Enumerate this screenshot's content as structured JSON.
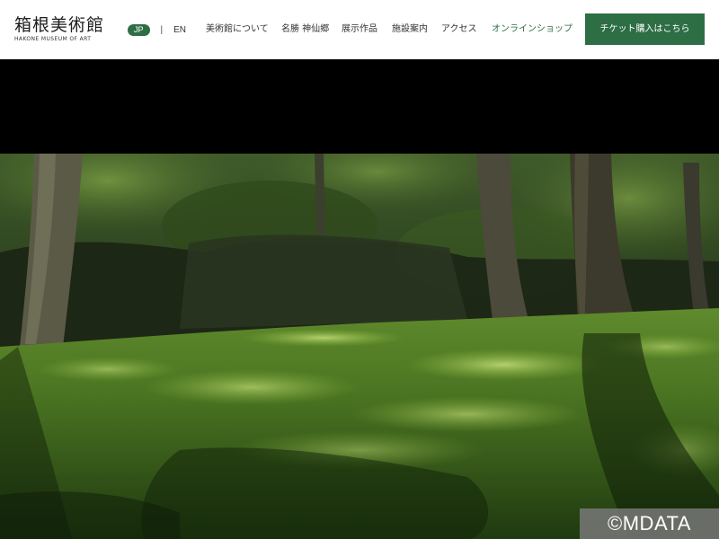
{
  "header": {
    "logo": {
      "title": "箱根美術館",
      "subtitle": "HAKONE MUSEUM OF ART"
    },
    "lang": {
      "jp": "JP",
      "separator": "|",
      "en": "EN"
    },
    "nav": [
      {
        "label": "美術館について"
      },
      {
        "label": "名勝 神仙郷"
      },
      {
        "label": "展示作品"
      },
      {
        "label": "施設案内"
      },
      {
        "label": "アクセス"
      },
      {
        "label": "オンラインショップ"
      }
    ],
    "ticket_button": "チケット購入はこちら"
  },
  "hero": {
    "image": "moss-garden-forest-photo"
  },
  "watermark": "©MDATA",
  "colors": {
    "accent": "#2d6e45"
  }
}
